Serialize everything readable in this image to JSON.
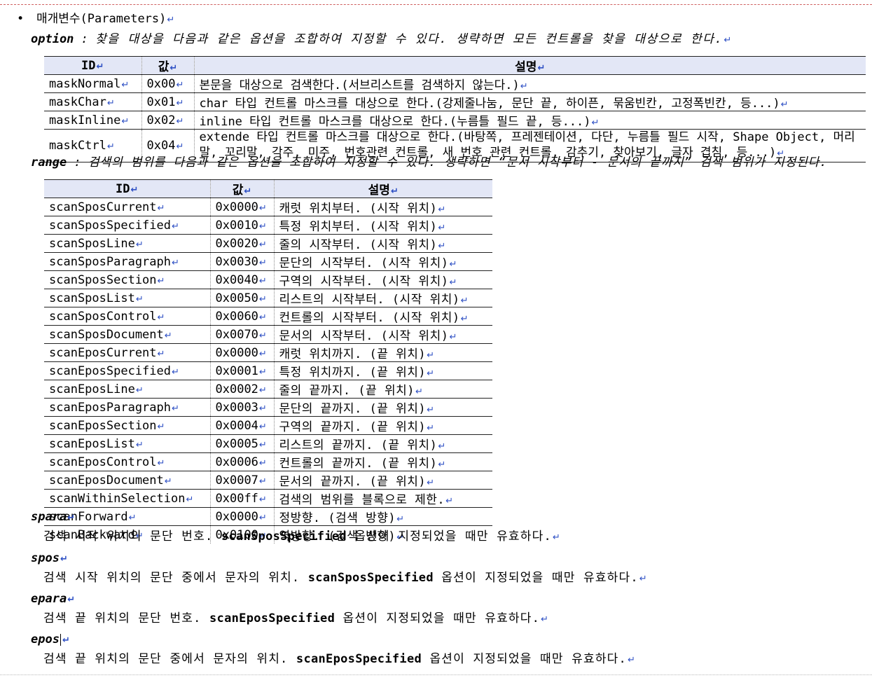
{
  "section": {
    "bullet": "•",
    "title": "매개변수(Parameters)"
  },
  "return_mark": "↵",
  "option": {
    "name": "option",
    "colon": ":",
    "text": "찾을 대상을 다음과 같은 옵션을 조합하여 지정할 수 있다. 생략하면 모든 컨트롤을 찾을 대상으로 한다."
  },
  "option_table": {
    "headers": [
      "ID",
      "값",
      "설명"
    ],
    "rows": [
      {
        "id": "maskNormal",
        "value": "0x00",
        "desc": "본문을 대상으로 검색한다.(서브리스트를 검색하지 않는다.)"
      },
      {
        "id": "maskChar",
        "value": "0x01",
        "desc": "char 타입 컨트롤 마스크를 대상으로 한다.(강제줄나눔, 문단 끝, 하이픈, 묶움빈칸, 고정폭빈칸, 등...)"
      },
      {
        "id": "maskInline",
        "value": "0x02",
        "desc": "inline 타입 컨트롤 마스크를 대상으로 한다.(누름틀 필드 끝, 등...)"
      },
      {
        "id": "maskCtrl",
        "value": "0x04",
        "desc": "extende 타입 컨트롤 마스크를 대상으로 한다.(바탕쪽, 프레젠테이션, 다단, 누름틀 필드 시작, Shape Object, 머리말, 꼬리말, 각주, 미주, 번호관련 컨트롤, 새 번호 관련 컨트롤, 감추기, 찾아보기, 글자 겹침, 등...)"
      }
    ]
  },
  "range": {
    "name": "range",
    "colon": ":",
    "text": "검색의 범위를 다음과 같은 옵션을 조합하여 지정할 수 있다. 생략하면 “문서 시작부터 - 문서의 끝까지” 검색 범위가 지정된다."
  },
  "range_table": {
    "headers": [
      "ID",
      "값",
      "설명"
    ],
    "rows": [
      {
        "id": "scanSposCurrent",
        "value": "0x0000",
        "desc": "캐럿 위치부터. (시작 위치)"
      },
      {
        "id": "scanSposSpecified",
        "value": "0x0010",
        "desc": "특정 위치부터. (시작 위치)"
      },
      {
        "id": "scanSposLine",
        "value": "0x0020",
        "desc": "줄의 시작부터. (시작 위치)"
      },
      {
        "id": "scanSposParagraph",
        "value": "0x0030",
        "desc": "문단의 시작부터. (시작 위치)"
      },
      {
        "id": "scanSposSection",
        "value": "0x0040",
        "desc": "구역의 시작부터. (시작 위치)"
      },
      {
        "id": "scanSposList",
        "value": "0x0050",
        "desc": "리스트의 시작부터. (시작 위치)"
      },
      {
        "id": "scanSposControl",
        "value": "0x0060",
        "desc": "컨트롤의 시작부터. (시작 위치)"
      },
      {
        "id": "scanSposDocument",
        "value": "0x0070",
        "desc": "문서의 시작부터. (시작 위치)"
      },
      {
        "id": "scanEposCurrent",
        "value": "0x0000",
        "desc": "캐럿 위치까지. (끝 위치)"
      },
      {
        "id": "scanEposSpecified",
        "value": "0x0001",
        "desc": "특정 위치까지. (끝 위치)"
      },
      {
        "id": "scanEposLine",
        "value": "0x0002",
        "desc": "줄의 끝까지. (끝 위치)"
      },
      {
        "id": "scanEposParagraph",
        "value": "0x0003",
        "desc": "문단의 끝까지. (끝 위치)"
      },
      {
        "id": "scanEposSection",
        "value": "0x0004",
        "desc": "구역의 끝까지. (끝 위치)"
      },
      {
        "id": "scanEposList",
        "value": "0x0005",
        "desc": "리스트의 끝까지. (끝 위치)"
      },
      {
        "id": "scanEposControl",
        "value": "0x0006",
        "desc": "컨트롤의 끝까지. (끝 위치)"
      },
      {
        "id": "scanEposDocument",
        "value": "0x0007",
        "desc": "문서의 끝까지. (끝 위치)"
      },
      {
        "id": "scanWithinSelection",
        "value": "0x00ff",
        "desc": "검색의 범위를 블록으로 제한."
      },
      {
        "id": "scanForward",
        "value": "0x0000",
        "desc": "정방향. (검색 방향)"
      },
      {
        "id": "scanBackward",
        "value": "0x0100",
        "desc": "역방향. (검색 방향)"
      }
    ]
  },
  "params": [
    {
      "name": "spara",
      "desc_before": "검색 시작 위치의 문단 번호. ",
      "code": "scanSposSpecified",
      "desc_after": " 옵션이 지정되었을 때만 유효하다."
    },
    {
      "name": "spos",
      "desc_before": "검색 시작 위치의 문단 중에서 문자의 위치. ",
      "code": "scanSposSpecified",
      "desc_after": " 옵션이 지정되었을 때만 유효하다."
    },
    {
      "name": "epara",
      "desc_before": "검색 끝 위치의 문단 번호. ",
      "code": "scanEposSpecified",
      "desc_after": " 옵션이 지정되었을 때만 유효하다."
    },
    {
      "name": "epos",
      "desc_before": "검색 끝 위치의 문단 중에서 문자의 위치. ",
      "code": "scanEposSpecified",
      "desc_after": " 옵션이 지정되었을 때만 유효하다."
    }
  ]
}
